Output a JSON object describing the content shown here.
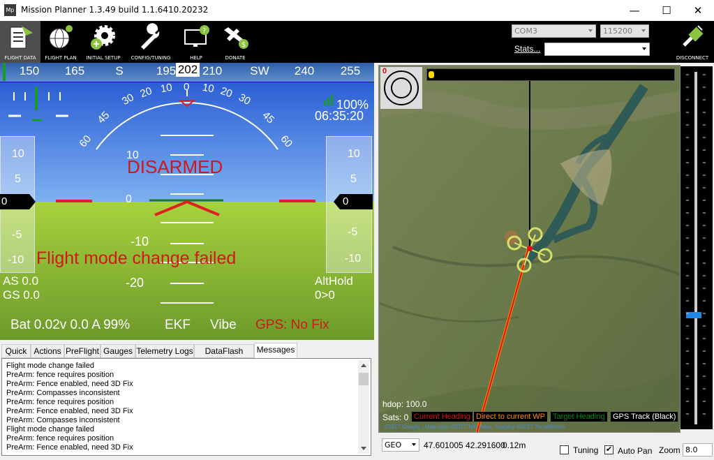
{
  "window": {
    "title": "Mission Planner 1.3.49 build 1.1.6410.20232",
    "app_icon": "Mp",
    "minimize": "—",
    "maximize": "☐",
    "close": "✕"
  },
  "toolbar": {
    "buttons": [
      {
        "label": "FLIGHT DATA",
        "icon": "flight-data-icon"
      },
      {
        "label": "FLIGHT PLAN",
        "icon": "globe-icon"
      },
      {
        "label": "INITIAL SETUP",
        "icon": "gear-plus-icon"
      },
      {
        "label": "CONFIG/TUNING",
        "icon": "wrench-icon"
      },
      {
        "label": "HELP",
        "icon": "monitor-help-icon"
      },
      {
        "label": "DONATE",
        "icon": "plane-dollar-icon"
      }
    ],
    "port": "COM3",
    "baud": "115200",
    "stats_label": "Stats...",
    "stats_value": "",
    "disconnect_label": "DISCONNECT"
  },
  "hud": {
    "heading_ticks": [
      "150",
      "165",
      "S",
      "195",
      "210",
      "SW",
      "240",
      "255"
    ],
    "heading_current": "202",
    "roll_marks": [
      "60",
      "45",
      "30",
      "20",
      "10",
      "0",
      "10",
      "20",
      "30",
      "45",
      "60"
    ],
    "pitch_marks": [
      "10",
      "0",
      "-10",
      "-20"
    ],
    "status": "DISARMED",
    "alert": "Flight mode change failed",
    "battery_pct": "100%",
    "time": "06:35:20",
    "speed_tape": [
      "10",
      "5",
      "-5",
      "-10"
    ],
    "speed_value": "0",
    "alt_tape": [
      "10",
      "5",
      "-5",
      "-10"
    ],
    "alt_value": "0",
    "airspeed": "AS 0.0",
    "groundspeed": "GS 0.0",
    "mode": "AltHold",
    "wp": "0>0",
    "battery": "Bat 0.02v 0.0 A 99%",
    "ekf": "EKF",
    "vibe": "Vibe",
    "gps": "GPS: No Fix",
    "colors": {
      "alert": "#d01818",
      "sky": "#2c5fd5",
      "ground": "#8fbc34"
    }
  },
  "tabs": [
    "Quick",
    "Actions",
    "PreFlight",
    "Gauges",
    "Telemetry Logs",
    "DataFlash Logs",
    "Messages"
  ],
  "selected_tab": "Messages",
  "messages": [
    "Flight mode change failed",
    "PreArm: fence requires position",
    "PreArm: Fence enabled, need 3D Fix",
    "PreArm: Compasses inconsistent",
    "PreArm: fence requires position",
    "PreArm: Fence enabled, need 3D Fix",
    "PreArm: Compasses inconsistent",
    "Flight mode change failed",
    "PreArm: fence requires position",
    "PreArm: Fence enabled, need 3D Fix"
  ],
  "map": {
    "hdop": "hdop: 100.0",
    "sats": "Sats: 0",
    "legend_current_heading": "Current Heading",
    "legend_direct_wp": "Direct to current WP",
    "legend_target_heading": "Target Heading",
    "legend_gps_track": "GPS Track (Black)",
    "copyright": "©2017 Google - Map data ©2017 Tele Atlas, Imagery ©2017 TerraMetrics",
    "red_counter": "0"
  },
  "bottom": {
    "coord_type": "GEO",
    "coords": "47.601005 42.291600",
    "distance": "0.12m",
    "tuning_label": "Tuning",
    "tuning_checked": false,
    "autopan_label": "Auto Pan",
    "autopan_checked": true,
    "zoom_label": "Zoom",
    "zoom_value": "8.0"
  }
}
